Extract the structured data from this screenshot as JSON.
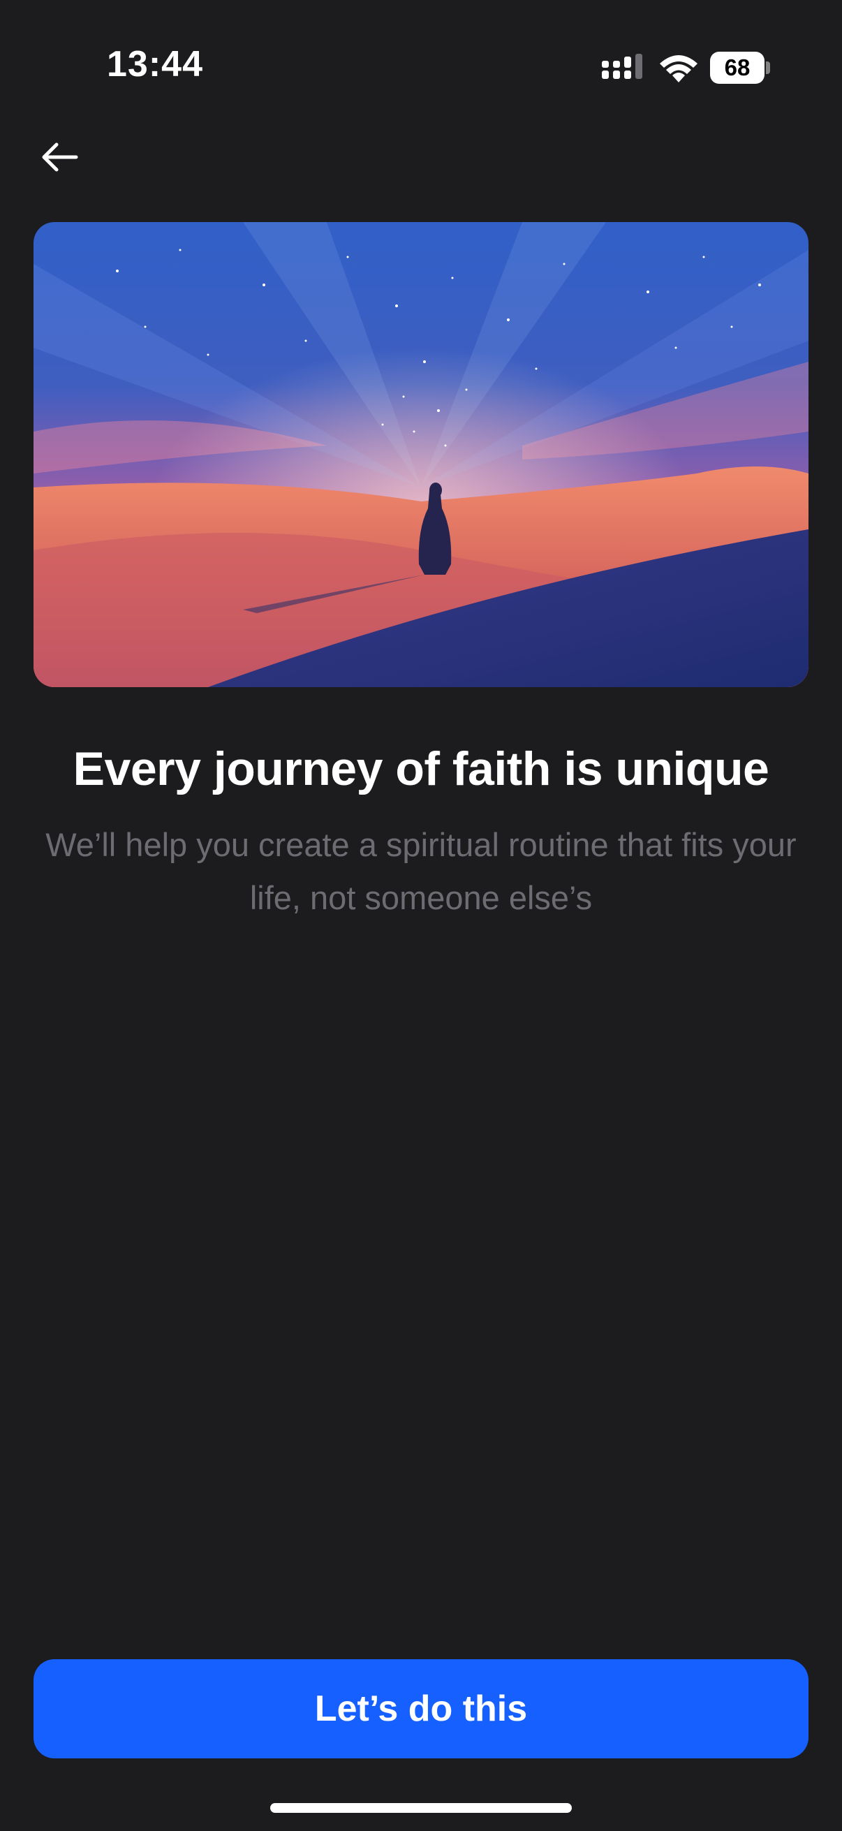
{
  "status_bar": {
    "time": "13:44",
    "battery_level": "68",
    "icons": [
      "signal-icon",
      "wifi-icon",
      "battery-icon"
    ]
  },
  "nav": {
    "back_icon": "arrow-left-icon"
  },
  "hero": {
    "image": "figure-walking-desert-starry-sky"
  },
  "content": {
    "title": "Every journey of faith is unique",
    "subtitle": "We’ll help you create a spiritual routine that fits your life, not someone else’s"
  },
  "cta": {
    "label": "Let’s do this"
  },
  "colors": {
    "background": "#1c1c1e",
    "primary": "#1660ff",
    "subtitle": "#6c6c72",
    "title": "#ffffff"
  }
}
